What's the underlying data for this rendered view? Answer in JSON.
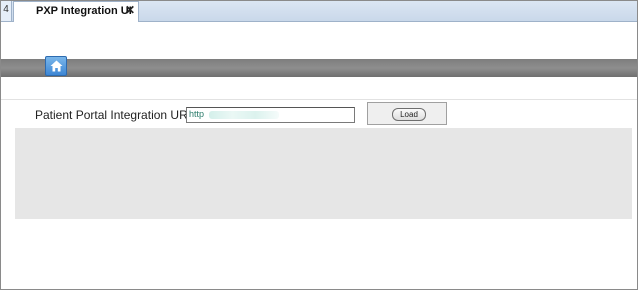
{
  "tabs": {
    "left_stub_glyph": "4",
    "active": {
      "title": "PXP Integration UI",
      "close_glyph": "✕"
    }
  },
  "toolbar": {
    "home_icon": "home-icon"
  },
  "form": {
    "label": "Patient Portal Integration URL:",
    "url_value": "http",
    "load_label": "Load"
  },
  "colors": {
    "nav_band": "#7d7d7d",
    "home_button": "#3d86d4",
    "content_panel": "#e6e6e6",
    "url_text": "#2a7b6a"
  }
}
